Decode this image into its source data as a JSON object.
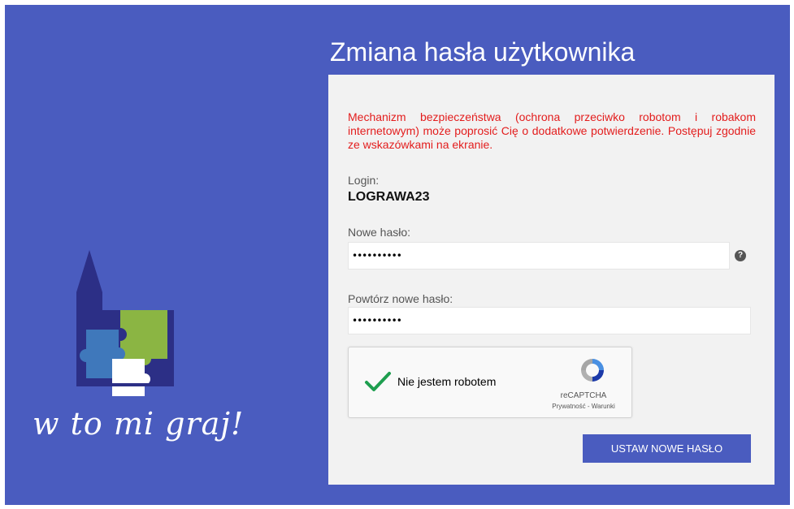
{
  "page": {
    "title": "Zmiana hasła użytkownika",
    "slogan": "w to mi graj!"
  },
  "form": {
    "warning": "Mechanizm bezpieczeństwa (ochrona przeciwko robotom i robakom internetowym) może poprosić Cię o dodatkowe potwierdzenie. Postępuj zgodnie ze wskazówkami na ekranie.",
    "login_label": "Login:",
    "login_value": "LOGRAWA23",
    "new_password_label": "Nowe hasło:",
    "new_password_value": "••••••••••",
    "repeat_password_label": "Powtórz nowe hasło:",
    "repeat_password_value": "••••••••••",
    "help_glyph": "?",
    "submit_label": "USTAW NOWE HASŁO"
  },
  "captcha": {
    "label": "Nie jestem robotem",
    "brand": "reCAPTCHA",
    "links": "Prywatność - Warunki",
    "checked": true
  },
  "colors": {
    "background": "#4a5cbf",
    "panel": "#f2f2f2",
    "warning": "#e31d1d",
    "button": "#4a5cbf",
    "check": "#1e9e4f"
  },
  "icons": {
    "logo": "castle-puzzle-logo",
    "help": "question-circle-icon",
    "check": "checkmark-icon",
    "recaptcha": "recaptcha-arrows-icon"
  }
}
